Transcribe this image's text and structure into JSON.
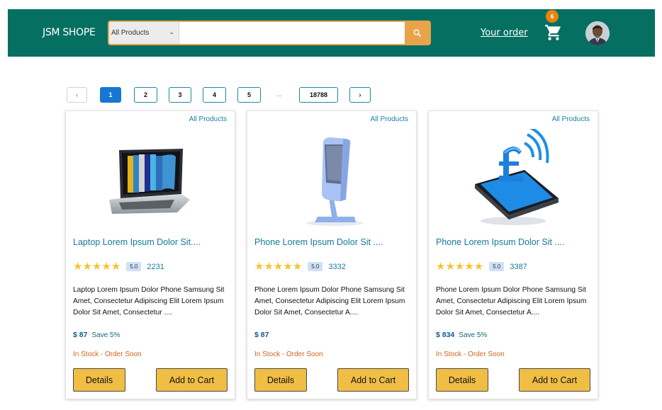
{
  "header": {
    "brand": "JSM SHOPE",
    "search": {
      "category": "All Products",
      "placeholder": ""
    },
    "your_order": "Your order",
    "cart_count": "6",
    "colors": {
      "bar": "#056f62",
      "accent": "#e8a34b"
    }
  },
  "pagination": {
    "prev": "‹",
    "next": "›",
    "pages": [
      "1",
      "2",
      "3",
      "4",
      "5"
    ],
    "ellipsis": "...",
    "last": "18788",
    "active": "1"
  },
  "products": [
    {
      "category": "All Products",
      "image": "laptop-books-image",
      "title": "Laptop Lorem Ipsum Dolor Sit....",
      "stars": "★★★★★",
      "rating": "5.0",
      "reviews": "2231",
      "description": "Laptop Lorem Ipsum Dolor Phone Samsung Sit Amet, Consectetur Adipiscing Elit Lorem Ipsum Dolor Sit Amet, Consectetur ....",
      "price": "$ 87",
      "save": "Save 5%",
      "stock": "In Stock - Order Soon",
      "details_label": "Details",
      "cart_label": "Add to Cart"
    },
    {
      "category": "All Products",
      "image": "kiosk-stand-image",
      "title": "Phone Lorem Ipsum Dolor Sit ....",
      "stars": "★★★★★",
      "rating": "5.0",
      "reviews": "3332",
      "description": "Phone Lorem Ipsum Dolor Phone Samsung Sit Amet, Consectetur Adipiscing Elit Lorem Ipsum Dolor Sit Amet, Consectetur A....",
      "price": "$ 87",
      "save": "",
      "stock": "In Stock - Order Soon",
      "details_label": "Details",
      "cart_label": "Add to Cart"
    },
    {
      "category": "All Products",
      "image": "phone-pound-image",
      "title": "Phone Lorem Ipsum Dolor Sit ....",
      "stars": "★★★★★",
      "rating": "5.0",
      "reviews": "3387",
      "description": "Phone Lorem Ipsum Dolor Phone Samsung Sit Amet, Consectetur Adipiscing Elit Lorem Ipsum Dolor Sit Amet, Consectetur A....",
      "price": "$ 834",
      "save": "Save 5%",
      "stock": "In Stock - Order Soon",
      "details_label": "Details",
      "cart_label": "Add to Cart"
    }
  ]
}
